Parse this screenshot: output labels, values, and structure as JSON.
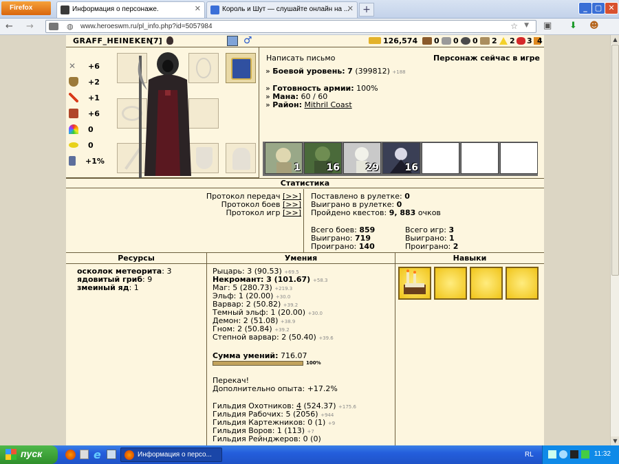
{
  "browser": {
    "app_button": "Firefox",
    "tabs": [
      {
        "title": "Информация о персонаже."
      },
      {
        "title": "Король и Шут — слушайте онлайн на ..."
      }
    ],
    "url": "www.heroeswm.ru/pl_info.php?id=5057984"
  },
  "profile": {
    "name": "GRAFF_HEINEKEN",
    "level": "[7]",
    "gold": "126,574",
    "resources_top": [
      "0",
      "0",
      "0",
      "2",
      "2",
      "3",
      "4"
    ],
    "write_letter": "Написать письмо",
    "online_status": "Персонаж сейчас в игре",
    "battle_level_label": "Боевой уровень:",
    "battle_level": "7",
    "battle_exp": "(399812)",
    "battle_exp_delta": "+188",
    "army_label": "Готовность армии:",
    "army_value": "100%",
    "mana_label": "Мана:",
    "mana_value": "60 / 60",
    "district_label": "Район:",
    "district_value": "Mithril Coast",
    "stats": [
      {
        "icon": "attack-icon",
        "value": "+6"
      },
      {
        "icon": "defense-icon",
        "value": "+2"
      },
      {
        "icon": "spellpower-icon",
        "value": "+1"
      },
      {
        "icon": "knowledge-icon",
        "value": "+6"
      },
      {
        "icon": "luck-icon",
        "value": "0"
      },
      {
        "icon": "morale-icon",
        "value": "0"
      },
      {
        "icon": "initiative-icon",
        "value": "+1%"
      }
    ],
    "army": [
      "1",
      "16",
      "29",
      "16",
      "",
      "",
      ""
    ]
  },
  "statistics": {
    "title": "Статистика",
    "links": [
      {
        "label": "Протокол передач",
        "link": "[>>]"
      },
      {
        "label": "Протокол боев",
        "link": "[>>]"
      },
      {
        "label": "Протокол игр",
        "link": "[>>]"
      }
    ],
    "roulette_bet_label": "Поставлено в рулетке:",
    "roulette_bet": "0",
    "roulette_won_label": "Выиграно в рулетке:",
    "roulette_won": "0",
    "quests_label": "Пройдено квестов:",
    "quests": "9, 883",
    "quests_unit": "очков",
    "battles_label": "Всего боев:",
    "battles": "859",
    "battles_won_label": "Выиграно:",
    "battles_won": "719",
    "battles_lost_label": "Проиграно:",
    "battles_lost": "140",
    "games_label": "Всего игр:",
    "games": "3",
    "games_won_label": "Выиграно:",
    "games_won": "1",
    "games_lost_label": "Проиграно:",
    "games_lost": "2"
  },
  "resources": {
    "title": "Ресурсы",
    "items": [
      {
        "name": "осколок метеорита",
        "value": "3"
      },
      {
        "name": "ядовитый гриб",
        "value": "9"
      },
      {
        "name": "змеиный яд",
        "value": "1"
      }
    ]
  },
  "skills": {
    "title": "Умения",
    "factions": [
      {
        "name": "Рыцарь:",
        "value": "3 (90.53)",
        "delta": "+69.5"
      },
      {
        "name": "Некромант:",
        "value": "3 (101.67)",
        "delta": "+58.3",
        "bold": true
      },
      {
        "name": "Маг:",
        "value": "5 (280.73)",
        "delta": "+219.3"
      },
      {
        "name": "Эльф:",
        "value": "1 (20.00)",
        "delta": "+30.0"
      },
      {
        "name": "Варвар:",
        "value": "2 (50.82)",
        "delta": "+39.2"
      },
      {
        "name": "Темный эльф:",
        "value": "1 (20.00)",
        "delta": "+30.0"
      },
      {
        "name": "Демон:",
        "value": "2 (51.08)",
        "delta": "+38.9"
      },
      {
        "name": "Гном:",
        "value": "2 (50.84)",
        "delta": "+39.2"
      },
      {
        "name": "Степной варвар:",
        "value": "2 (50.40)",
        "delta": "+39.6"
      }
    ],
    "sum_label": "Сумма умений:",
    "sum_value": "716.07",
    "sum_progress": "100%",
    "perk": "Перекач!",
    "extra_exp_label": "Дополнительно опыта:",
    "extra_exp_value": "+17.2%",
    "guilds": [
      {
        "name": "Гильдия Охотников:",
        "value": "4",
        "extra": "(524.37)",
        "delta": "+175.6",
        "link": true
      },
      {
        "name": "Гильдия Рабочих:",
        "value": "5 (2056)",
        "delta": "+944"
      },
      {
        "name": "Гильдия Картежников:",
        "value": "0 (1)",
        "delta": "+9"
      },
      {
        "name": "Гильдия Воров:",
        "value": "1 (113)",
        "delta": "+7"
      },
      {
        "name": "Гильдия Рейнджеров:",
        "value": "0 (0)",
        "delta": ""
      }
    ]
  },
  "abilities": {
    "title": "Навыки"
  },
  "taskbar": {
    "start": "пуск",
    "item": "Информация о персо...",
    "lang": "RL",
    "clock": "11:32"
  }
}
